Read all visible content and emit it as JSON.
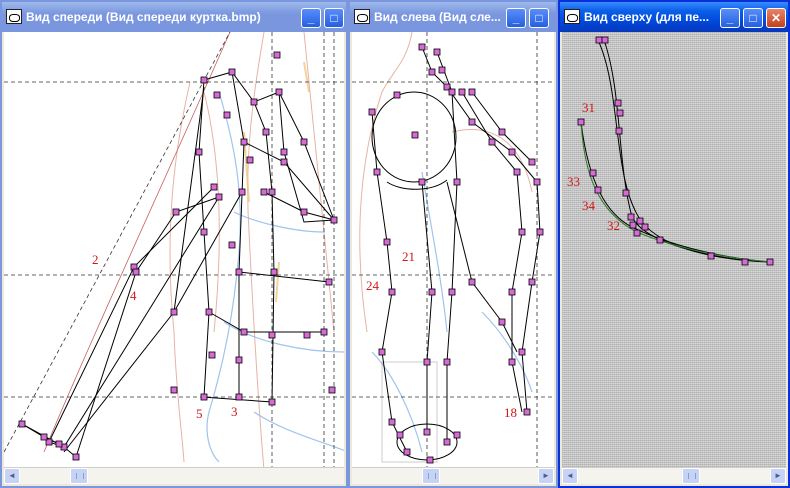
{
  "windows": [
    {
      "id": "front",
      "title": "Вид спереди (Вид спереди куртка.bmp)",
      "active": false,
      "labels": [
        "2",
        "4",
        "5",
        "3"
      ]
    },
    {
      "id": "left",
      "title": "Вид слева (Вид сле...",
      "active": false,
      "labels": [
        "21",
        "24",
        "18"
      ]
    },
    {
      "id": "top",
      "title": "Вид сверху (для пе...",
      "active": true,
      "labels": [
        "31",
        "33",
        "34",
        "32"
      ]
    }
  ],
  "buttons": {
    "minimize": "_",
    "maximize": "□",
    "close": "✕"
  },
  "scroll": {
    "left_arrow": "◄",
    "right_arrow": "►"
  },
  "colors": {
    "active_title": "#0a5fe8",
    "inactive_title": "#7a96df",
    "point_fill": "#d66ad6",
    "label": "#d01818"
  },
  "icons": [
    "app-icon",
    "minimize-icon",
    "maximize-icon",
    "close-icon",
    "scroll-left-icon",
    "scroll-right-icon"
  ]
}
